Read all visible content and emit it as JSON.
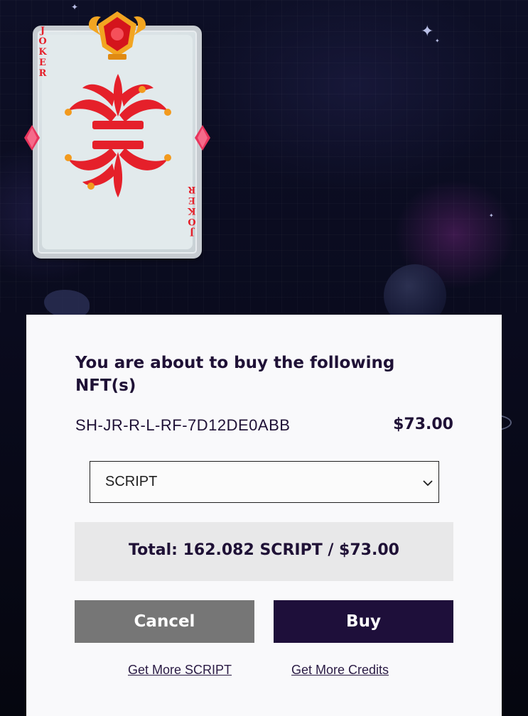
{
  "card": {
    "label_top": [
      "J",
      "O",
      "K",
      "E",
      "R"
    ],
    "label_bottom": [
      "J",
      "O",
      "K",
      "E",
      "R"
    ],
    "colors": {
      "frame": "#c7ccd1",
      "face": "#e2eaec",
      "jester": "#e5202a",
      "accent": "#f29a1d"
    }
  },
  "modal": {
    "title": "You are about to buy the following NFT(s)",
    "nft_id": "SH-JR-R-L-RF-7D12DE0ABB",
    "nft_price": "$73.00",
    "currency_select": {
      "selected": "SCRIPT",
      "icon": "chevron-down-icon"
    },
    "total": "Total: 162.082 SCRIPT / $73.00",
    "cancel_label": "Cancel",
    "buy_label": "Buy",
    "link_script": "Get More SCRIPT",
    "link_credits": "Get More Credits"
  },
  "colors": {
    "primary_dark": "#1e0f3a",
    "cancel_gray": "#767676",
    "total_bg": "#e8e8e9",
    "modal_bg": "#f9f9fb"
  }
}
